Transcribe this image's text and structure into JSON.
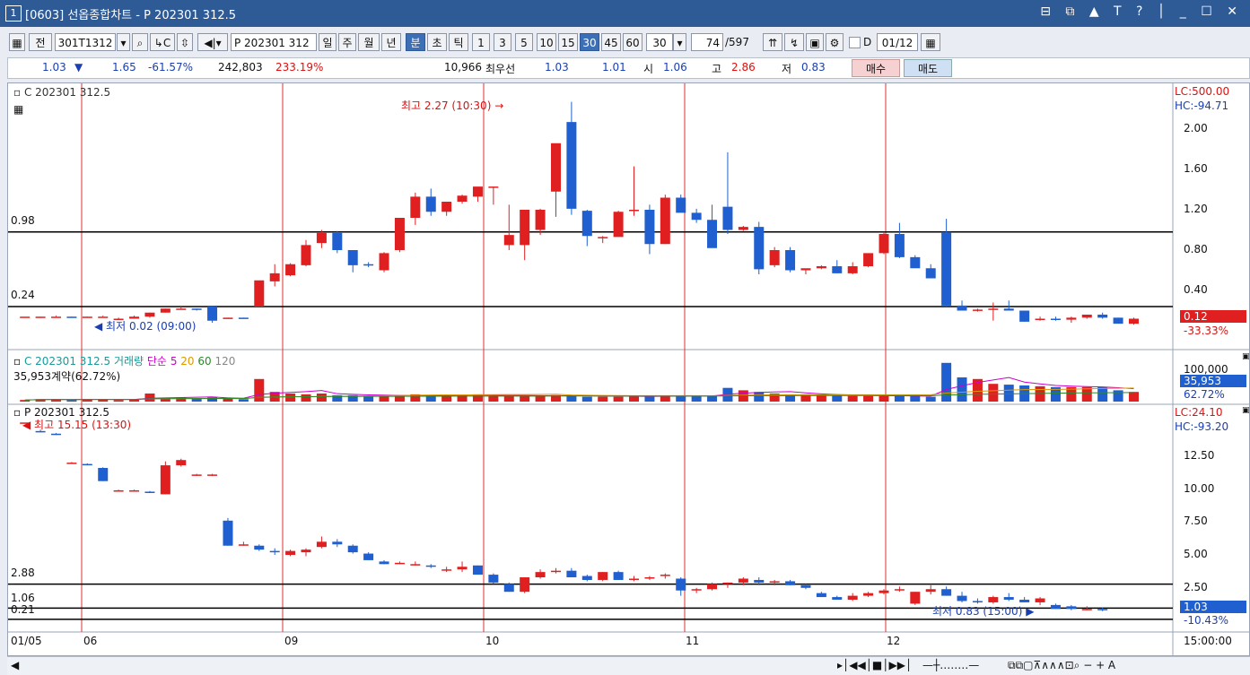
{
  "window": {
    "number": "1",
    "title": "[0603] 선옵종합차트 - P 202301 312.5",
    "buttons": "⊟ ⧉ ▲ T ? │ _ ☐ ✕"
  },
  "toolbar": {
    "jeon": "전",
    "code": "301T1312",
    "product": "P 202301 312",
    "periods": [
      "일",
      "주",
      "월",
      "년"
    ],
    "units": [
      "분",
      "초",
      "틱"
    ],
    "intervals": [
      "1",
      "3",
      "5",
      "10",
      "15",
      "30",
      "45",
      "60"
    ],
    "selected_interval": "30",
    "interval_value": "30",
    "count": "74",
    "total": "/597",
    "d_label": "D",
    "date": "01/12"
  },
  "info": {
    "price": "1.03",
    "arrow": "▼",
    "change": "1.65",
    "change_pct": "-61.57%",
    "volume": "242,803",
    "vol_pct": "233.19%",
    "qty": "10,966",
    "best_label": "최우선",
    "best_ask": "1.03",
    "best_bid": "1.01",
    "open_label": "시",
    "open": "1.06",
    "high_label": "고",
    "high": "2.86",
    "low_label": "저",
    "low": "0.83",
    "buy": "매수",
    "sell": "매도"
  },
  "panel1": {
    "title": "C 202301 312.5",
    "max_label": "최고 2.27 (10:30)",
    "min_label": "최저 0.02 (09:00)",
    "lc": "LC:500.00",
    "hc": "HC:-94.71",
    "hline1": "0.98",
    "hline2": "0.24",
    "axis": [
      "2.00",
      "1.60",
      "1.20",
      "0.80",
      "0.40"
    ],
    "cur": "0.12",
    "cur_pct": "-33.33%"
  },
  "panel2": {
    "title": "C 202301 312.5 거래량",
    "ma_label": "단순",
    "ma": [
      "5",
      "20",
      "60",
      "120"
    ],
    "info": "35,953계약(62.72%)",
    "axis_top": "100,000",
    "cur": "35,953",
    "cur_pct": "62.72%"
  },
  "panel3": {
    "title": "P 202301 312.5",
    "max_label": "최고 15.15 (13:30)",
    "min_label": "최저 0.83 (15:00)",
    "lc": "LC:24.10",
    "hc": "HC:-93.20",
    "hline1": "2.88",
    "hline2": "1.06",
    "hline3": "0.21",
    "axis": [
      "12.50",
      "10.00",
      "7.50",
      "5.00",
      "2.50"
    ],
    "cur": "1.03",
    "cur_pct": "-10.43%"
  },
  "xaxis": {
    "labels": [
      "01/05",
      "06",
      "09",
      "10",
      "11",
      "12"
    ],
    "time": "15:00:00"
  },
  "colors": {
    "up": "#e02020",
    "down": "#1f5fcf",
    "title": "#2e5a96"
  },
  "chart_data": [
    {
      "type": "candlestick",
      "title": "C 202301 312.5",
      "ohlc": [
        [
          0.14,
          0.14,
          0.14,
          0.14
        ],
        [
          0.13,
          0.14,
          0.13,
          0.14
        ],
        [
          0.14,
          0.15,
          0.14,
          0.14
        ],
        [
          0.14,
          0.14,
          0.13,
          0.13
        ],
        [
          0.13,
          0.14,
          0.13,
          0.14
        ],
        [
          0.14,
          0.15,
          0.14,
          0.14
        ],
        [
          0.12,
          0.13,
          0.12,
          0.12
        ],
        [
          0.12,
          0.15,
          0.12,
          0.14
        ],
        [
          0.14,
          0.18,
          0.13,
          0.18
        ],
        [
          0.18,
          0.22,
          0.18,
          0.22
        ],
        [
          0.22,
          0.25,
          0.22,
          0.22
        ],
        [
          0.22,
          0.22,
          0.2,
          0.21
        ],
        [
          0.24,
          0.25,
          0.08,
          0.1
        ],
        [
          0.12,
          0.13,
          0.12,
          0.13
        ],
        [
          0.13,
          0.13,
          0.12,
          0.12
        ],
        [
          0.24,
          0.25,
          0.3,
          0.5
        ],
        [
          0.49,
          0.66,
          0.44,
          0.57
        ],
        [
          0.55,
          0.67,
          0.54,
          0.66
        ],
        [
          0.65,
          0.9,
          0.64,
          0.85
        ],
        [
          0.87,
          1.0,
          0.82,
          0.97
        ],
        [
          0.97,
          0.99,
          0.77,
          0.8
        ],
        [
          0.8,
          0.8,
          0.58,
          0.65
        ],
        [
          0.66,
          0.68,
          0.63,
          0.65
        ],
        [
          0.6,
          0.78,
          0.58,
          0.77
        ],
        [
          0.8,
          1.12,
          0.78,
          1.12
        ],
        [
          1.12,
          1.37,
          1.05,
          1.33
        ],
        [
          1.33,
          1.41,
          1.14,
          1.18
        ],
        [
          1.18,
          1.28,
          1.14,
          1.28
        ],
        [
          1.28,
          1.35,
          1.26,
          1.34
        ],
        [
          1.33,
          1.42,
          1.28,
          1.43
        ],
        [
          1.43,
          1.43,
          1.25,
          1.43
        ],
        [
          0.85,
          1.25,
          0.8,
          0.95
        ],
        [
          0.85,
          1.09,
          0.7,
          1.2
        ],
        [
          1.0,
          1.21,
          0.95,
          1.2
        ],
        [
          1.38,
          1.52,
          1.13,
          1.86
        ],
        [
          2.07,
          2.27,
          1.15,
          1.21
        ],
        [
          1.19,
          1.2,
          0.84,
          0.94
        ],
        [
          0.92,
          0.94,
          0.87,
          0.93
        ],
        [
          0.93,
          1.19,
          0.95,
          1.18
        ],
        [
          1.2,
          1.63,
          1.14,
          1.2
        ],
        [
          1.2,
          1.25,
          0.76,
          0.86
        ],
        [
          0.86,
          1.35,
          0.86,
          1.32
        ],
        [
          1.32,
          1.35,
          1.18,
          1.17
        ],
        [
          1.17,
          1.21,
          1.07,
          1.1
        ],
        [
          1.1,
          1.25,
          0.86,
          0.82
        ],
        [
          1.23,
          1.77,
          0.96,
          1.0
        ],
        [
          1.0,
          1.04,
          0.99,
          1.03
        ],
        [
          1.03,
          1.08,
          0.56,
          0.61
        ],
        [
          0.65,
          0.83,
          0.63,
          0.8
        ],
        [
          0.8,
          0.83,
          0.58,
          0.6
        ],
        [
          0.6,
          0.6,
          0.56,
          0.62
        ],
        [
          0.62,
          0.65,
          0.61,
          0.64
        ],
        [
          0.64,
          0.7,
          0.57,
          0.57
        ],
        [
          0.57,
          0.68,
          0.56,
          0.64
        ],
        [
          0.64,
          0.76,
          0.63,
          0.77
        ],
        [
          0.77,
          0.98,
          0.76,
          0.96
        ],
        [
          0.96,
          1.07,
          0.72,
          0.73
        ],
        [
          0.73,
          0.75,
          0.64,
          0.62
        ],
        [
          0.62,
          0.66,
          0.52,
          0.52
        ],
        [
          0.98,
          1.11,
          0.24,
          0.25
        ],
        [
          0.25,
          0.3,
          0.2,
          0.2
        ],
        [
          0.2,
          0.22,
          0.19,
          0.21
        ],
        [
          0.21,
          0.28,
          0.1,
          0.22
        ],
        [
          0.22,
          0.3,
          0.2,
          0.2
        ],
        [
          0.2,
          0.2,
          0.09,
          0.09
        ],
        [
          0.12,
          0.14,
          0.1,
          0.12
        ],
        [
          0.12,
          0.14,
          0.1,
          0.11
        ],
        [
          0.11,
          0.14,
          0.08,
          0.13
        ],
        [
          0.13,
          0.16,
          0.12,
          0.16
        ],
        [
          0.16,
          0.18,
          0.12,
          0.13
        ],
        [
          0.13,
          0.13,
          0.08,
          0.07
        ],
        [
          0.07,
          0.13,
          0.06,
          0.12
        ]
      ]
    },
    {
      "type": "bar",
      "title": "C 202301 312.5 거래량",
      "values": [
        2,
        3,
        3,
        2,
        3,
        3,
        2,
        3,
        10,
        5,
        5,
        4,
        5,
        4,
        3,
        28,
        12,
        10,
        9,
        10,
        8,
        8,
        7,
        7,
        8,
        9,
        8,
        7,
        8,
        9,
        7,
        7,
        7,
        7,
        8,
        8,
        6,
        6,
        6,
        7,
        7,
        7,
        7,
        7,
        7,
        17,
        14,
        12,
        10,
        9,
        9,
        8,
        8,
        7,
        7,
        7,
        7,
        7,
        6,
        48,
        30,
        28,
        22,
        21,
        20,
        19,
        18,
        18,
        18,
        18,
        14,
        12
      ]
    },
    {
      "type": "candlestick",
      "title": "P 202301 312.5",
      "ohlc": [
        [
          15.15,
          15.15,
          15.15,
          15.15
        ],
        [
          14.5,
          14.6,
          14.4,
          14.4
        ],
        [
          14.3,
          14.35,
          14.2,
          14.2
        ],
        [
          12.1,
          12.15,
          12.05,
          12.1
        ],
        [
          12.0,
          12.05,
          11.9,
          11.9
        ],
        [
          11.7,
          11.75,
          10.7,
          10.7
        ],
        [
          10.0,
          10.05,
          9.95,
          10.0
        ],
        [
          10.0,
          10.05,
          9.95,
          10.0
        ],
        [
          9.9,
          9.95,
          9.8,
          9.8
        ],
        [
          9.7,
          12.2,
          9.7,
          11.9
        ],
        [
          11.9,
          12.4,
          11.8,
          12.3
        ],
        [
          11.2,
          11.25,
          11.1,
          11.2
        ],
        [
          11.2,
          11.25,
          11.1,
          11.2
        ],
        [
          7.7,
          7.9,
          5.8,
          5.8
        ],
        [
          5.9,
          6.1,
          5.8,
          5.9
        ],
        [
          5.8,
          5.9,
          5.4,
          5.5
        ],
        [
          5.4,
          5.6,
          5.1,
          5.3
        ],
        [
          5.1,
          5.5,
          5.0,
          5.4
        ],
        [
          5.3,
          5.6,
          5.0,
          5.5
        ],
        [
          5.7,
          6.5,
          5.6,
          6.1
        ],
        [
          6.1,
          6.3,
          5.7,
          5.9
        ],
        [
          5.8,
          5.9,
          5.2,
          5.3
        ],
        [
          5.2,
          5.3,
          4.7,
          4.7
        ],
        [
          4.6,
          4.7,
          4.4,
          4.4
        ],
        [
          4.4,
          4.6,
          4.4,
          4.5
        ],
        [
          4.4,
          4.6,
          4.3,
          4.4
        ],
        [
          4.3,
          4.4,
          4.1,
          4.2
        ],
        [
          4.0,
          4.2,
          3.8,
          4.0
        ],
        [
          4.0,
          4.6,
          3.8,
          4.2
        ],
        [
          4.3,
          4.3,
          3.6,
          3.6
        ],
        [
          3.6,
          3.7,
          2.9,
          3.0
        ],
        [
          2.9,
          3.0,
          2.3,
          2.3
        ],
        [
          2.3,
          3.0,
          2.2,
          3.4
        ],
        [
          3.4,
          4.0,
          3.3,
          3.8
        ],
        [
          3.8,
          4.1,
          3.7,
          3.9
        ],
        [
          3.9,
          4.1,
          3.4,
          3.4
        ],
        [
          3.5,
          3.6,
          3.1,
          3.2
        ],
        [
          3.2,
          3.8,
          3.1,
          3.8
        ],
        [
          3.8,
          3.9,
          3.2,
          3.2
        ],
        [
          3.2,
          3.5,
          3.1,
          3.3
        ],
        [
          3.3,
          3.5,
          3.2,
          3.4
        ],
        [
          3.5,
          3.7,
          3.3,
          3.6
        ],
        [
          3.3,
          3.4,
          2.0,
          2.4
        ],
        [
          2.4,
          2.6,
          2.2,
          2.5
        ],
        [
          2.5,
          3.0,
          2.4,
          2.9
        ],
        [
          2.9,
          3.0,
          2.6,
          3.0
        ],
        [
          3.0,
          3.4,
          2.8,
          3.3
        ],
        [
          3.2,
          3.4,
          2.8,
          3.0
        ],
        [
          3.0,
          3.2,
          2.8,
          3.1
        ],
        [
          3.1,
          3.2,
          2.8,
          2.8
        ],
        [
          2.8,
          2.9,
          2.5,
          2.6
        ],
        [
          2.2,
          2.3,
          1.9,
          1.9
        ],
        [
          1.9,
          2.0,
          1.7,
          1.7
        ],
        [
          1.7,
          2.2,
          1.6,
          2.0
        ],
        [
          2.0,
          2.3,
          1.9,
          2.2
        ],
        [
          2.2,
          2.5,
          2.1,
          2.4
        ],
        [
          2.4,
          2.7,
          2.3,
          2.5
        ],
        [
          1.4,
          2.3,
          1.3,
          2.3
        ],
        [
          2.3,
          2.8,
          2.1,
          2.5
        ],
        [
          2.5,
          2.7,
          2.0,
          2.0
        ],
        [
          2.0,
          2.3,
          1.5,
          1.6
        ],
        [
          1.6,
          1.8,
          1.4,
          1.5
        ],
        [
          1.5,
          2.0,
          1.4,
          1.9
        ],
        [
          1.9,
          2.2,
          1.6,
          1.7
        ],
        [
          1.7,
          1.9,
          1.5,
          1.5
        ],
        [
          1.5,
          1.9,
          1.3,
          1.8
        ],
        [
          1.3,
          1.4,
          1.0,
          1.0
        ],
        [
          1.2,
          1.3,
          0.9,
          1.0
        ],
        [
          1.0,
          1.2,
          0.9,
          1.0
        ],
        [
          1.0,
          1.1,
          0.83,
          0.9
        ]
      ]
    }
  ]
}
